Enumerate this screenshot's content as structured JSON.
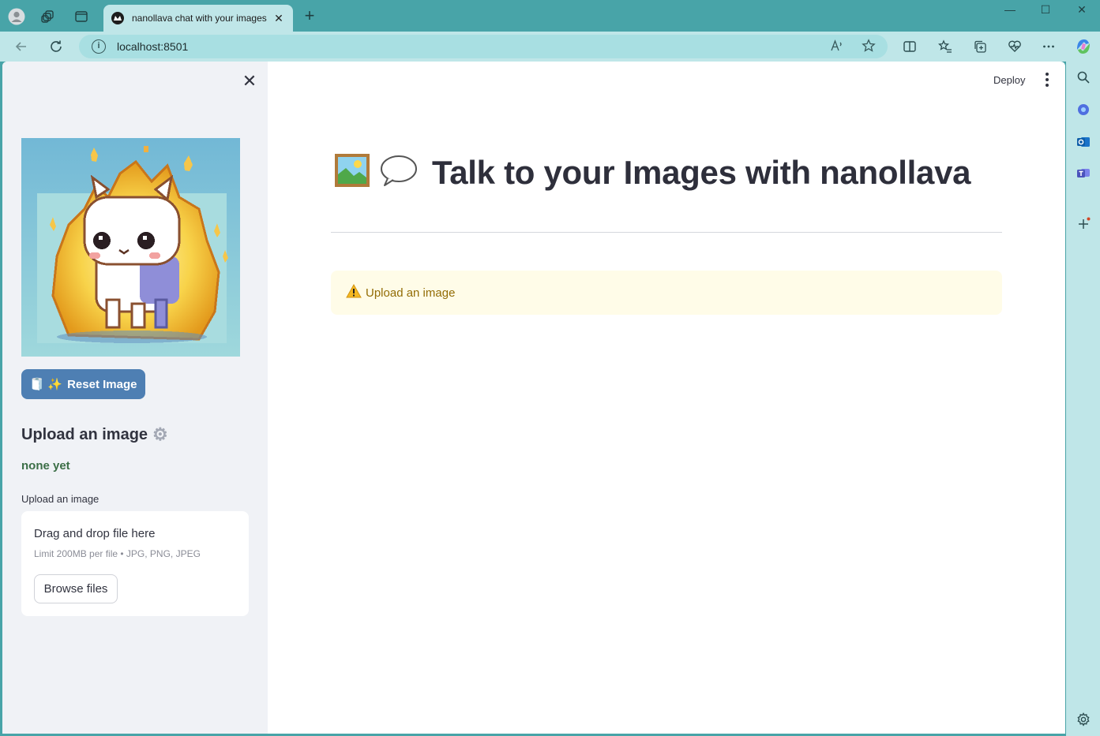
{
  "browser": {
    "tab_title": "nanollava chat with your images",
    "url": "localhost:8501",
    "new_tab_symbol": "+",
    "tab_close_symbol": "✕"
  },
  "app": {
    "header": {
      "deploy_label": "Deploy"
    },
    "sidebar": {
      "close_symbol": "✕",
      "reset_button_label": "Reset Image",
      "reset_button_icons": "🧻 ✨",
      "upload_heading": "Upload an image",
      "status_text": "none yet",
      "uploader_label": "Upload an image",
      "dropzone_title": "Drag and drop file here",
      "dropzone_limit": "Limit 200MB per file • JPG, PNG, JPEG",
      "browse_button_label": "Browse files"
    },
    "main": {
      "title": "Talk to your Images with nanollava",
      "warning_text": "Upload an image"
    }
  },
  "colors": {
    "chrome_teal": "#48a4a8",
    "toolbar": "#bfe6e8",
    "reset_button": "#4e7fb3",
    "warning_bg": "#fffce8",
    "warning_text": "#926c05",
    "status_green": "#3b6e46"
  }
}
